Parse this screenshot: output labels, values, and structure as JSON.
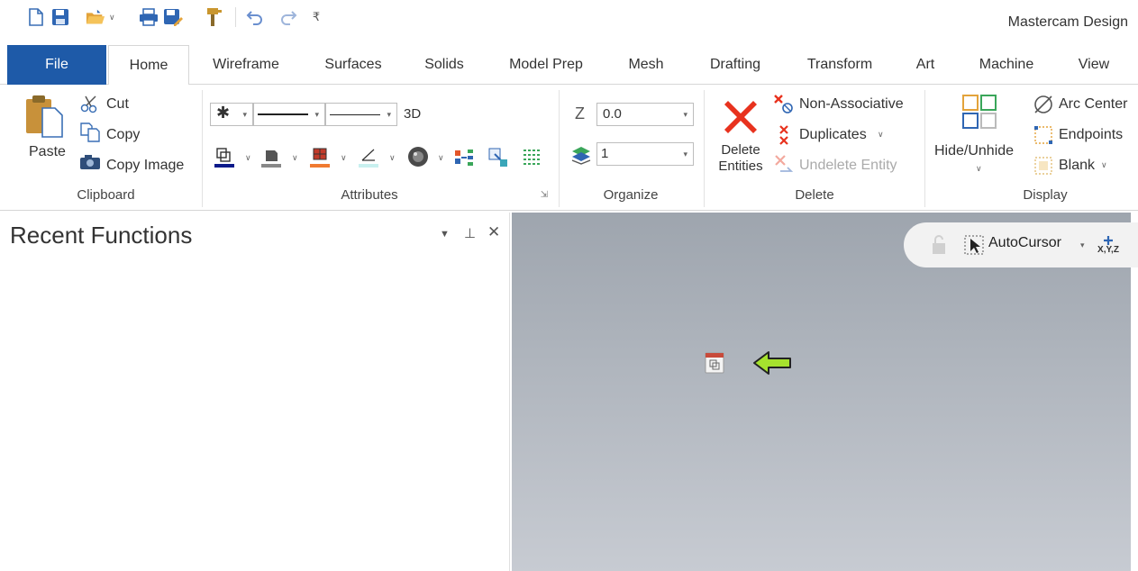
{
  "app_title": "Mastercam Design",
  "qat": {
    "icons": [
      "new-file-icon",
      "save-icon",
      "open-folder-icon",
      "print-icon",
      "save-as-icon",
      "paint-brush-icon",
      "undo-icon",
      "redo-icon",
      "customize-icon"
    ]
  },
  "tabs": [
    "File",
    "Home",
    "Wireframe",
    "Surfaces",
    "Solids",
    "Model Prep",
    "Mesh",
    "Drafting",
    "Transform",
    "Art",
    "Machine",
    "View"
  ],
  "ribbon": {
    "clipboard": {
      "label": "Clipboard",
      "paste": "Paste",
      "cut": "Cut",
      "copy": "Copy",
      "copy_image": "Copy Image"
    },
    "attributes": {
      "label": "Attributes",
      "mode_3d": "3D"
    },
    "organize": {
      "label": "Organize",
      "z_label": "Z",
      "z_value": "0.0",
      "level_value": "1"
    },
    "delete": {
      "label": "Delete",
      "delete_entities_line1": "Delete",
      "delete_entities_line2": "Entities",
      "non_associative": "Non-Associative",
      "duplicates": "Duplicates",
      "undelete_entity": "Undelete Entity"
    },
    "display": {
      "label": "Display",
      "hide_unhide": "Hide/Unhide",
      "arc_center": "Arc Center",
      "endpoints": "Endpoints",
      "blank": "Blank"
    }
  },
  "panel": {
    "title": "Recent Functions"
  },
  "viewport": {
    "autocursor": "AutoCursor",
    "xyz_label": "X,Y,Z"
  },
  "colors": {
    "file_tab": "#1e5aa8",
    "viewport_top": "#9ea5ae",
    "viewport_bottom": "#c7cbd2",
    "arrow": "#a6e22e",
    "delete_x": "#e8321e"
  }
}
